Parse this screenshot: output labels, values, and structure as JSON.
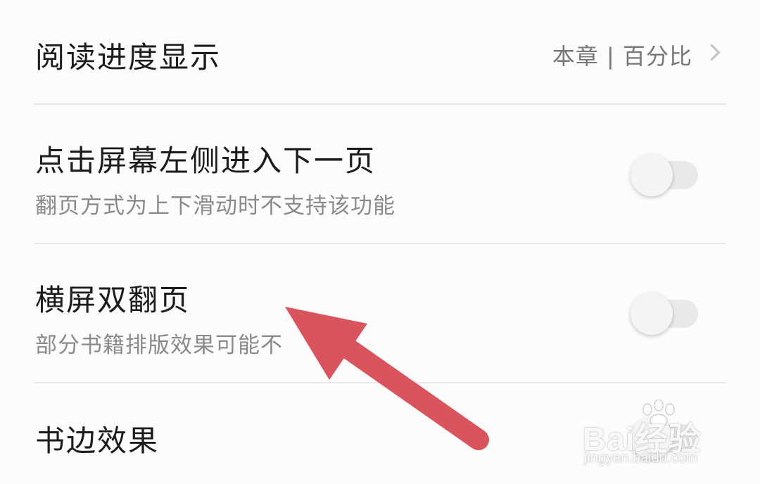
{
  "settings": {
    "reading_progress": {
      "title": "阅读进度显示",
      "value": "本章 | 百分比"
    },
    "tap_left_next_page": {
      "title": "点击屏幕左侧进入下一页",
      "subtitle": "翻页方式为上下滑动时不支持该功能",
      "enabled": false
    },
    "landscape_double_page": {
      "title": "横屏双翻页",
      "subtitle": "部分书籍排版效果可能不",
      "enabled": false
    },
    "page_edge_effect": {
      "title": "书边效果",
      "enabled": false
    }
  },
  "annotation": {
    "arrow_color": "#d9545d"
  },
  "watermark": {
    "brand": "Bai经验",
    "url": "jingyan.baidu.com"
  },
  "icons": [
    "chevron-right-icon",
    "paw-icon"
  ]
}
